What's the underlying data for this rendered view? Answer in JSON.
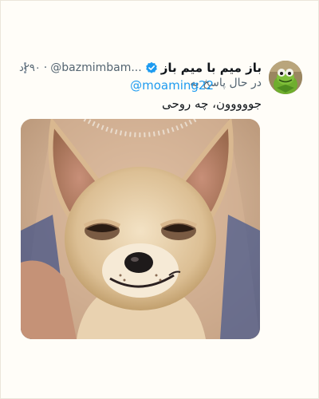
{
  "tweet": {
    "display_name": "باز میم با میم باز",
    "handle": "@bazmimbam...",
    "separator": "·",
    "time": "۲۹۰د",
    "replying_prefix": "در حال پاسخ به",
    "replying_handle": "@moaming22",
    "text": "جووووون، چه روحی",
    "media_alt_icon": "smirking-chihuahua-photo",
    "verified_color": "#1d9bf0",
    "link_color": "#1d9bf0"
  },
  "icons": {
    "more": "more-vertical-icon",
    "verified": "verified-badge-icon",
    "avatar": "kermit-avatar"
  }
}
